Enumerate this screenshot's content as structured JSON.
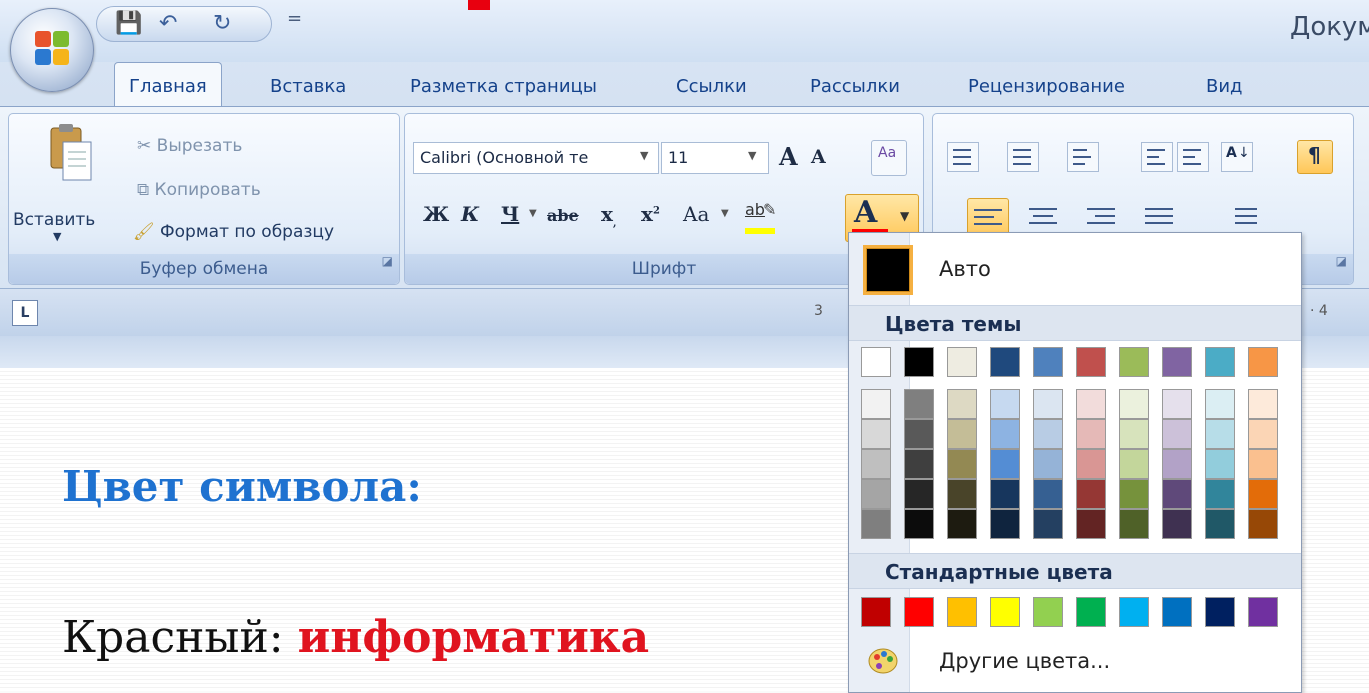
{
  "window": {
    "doc_title": "Докум"
  },
  "quick_access": {
    "icons": [
      "save-icon",
      "undo-icon",
      "redo-icon"
    ],
    "more": "="
  },
  "tabs": [
    "Главная",
    "Вставка",
    "Разметка страницы",
    "Ссылки",
    "Рассылки",
    "Рецензирование",
    "Вид"
  ],
  "clipboard": {
    "paste": "Вставить",
    "cut": "Вырезать",
    "copy": "Копировать",
    "format_painter": "Формат по образцу",
    "group_label": "Буфер обмена"
  },
  "font": {
    "font_name": "Calibri (Основной те",
    "font_size": "11",
    "grow": "A",
    "shrink": "A",
    "bold": "Ж",
    "italic": "К",
    "underline": "Ч",
    "strike": "abe",
    "subscript": "x",
    "superscript": "x",
    "change_case": "Aa",
    "highlight": "ab",
    "font_color": "A",
    "group_label": "Шрифт"
  },
  "paragraph": {
    "sort": "А",
    "show_marks": "¶"
  },
  "ruler": {
    "left_num": "3",
    "right_num": "· 4"
  },
  "font_color_menu": {
    "auto_label": "Авто",
    "theme_header": "Цвета темы",
    "theme_top_row": [
      "#ffffff",
      "#000000",
      "#eeece1",
      "#1f497d",
      "#4f81bd",
      "#c0504d",
      "#9bbb59",
      "#8064a2",
      "#4bacc6",
      "#f79646"
    ],
    "theme_shades": [
      [
        "#f2f2f2",
        "#7f7f7f",
        "#ddd9c3",
        "#c6d9f0",
        "#dbe5f1",
        "#f2dcdb",
        "#ebf1dd",
        "#e5e0ec",
        "#dbeef3",
        "#fdeada"
      ],
      [
        "#d8d8d8",
        "#595959",
        "#c4bd97",
        "#8db3e2",
        "#b8cce4",
        "#e5b9b7",
        "#d7e3bc",
        "#ccc1d9",
        "#b7dde8",
        "#fbd5b5"
      ],
      [
        "#bfbfbf",
        "#3f3f3f",
        "#938953",
        "#548dd4",
        "#95b3d7",
        "#d99694",
        "#c3d69b",
        "#b2a2c7",
        "#92cddc",
        "#fac08f"
      ],
      [
        "#a5a5a5",
        "#262626",
        "#494429",
        "#17365d",
        "#366092",
        "#953734",
        "#76923c",
        "#5f497a",
        "#31859b",
        "#e36c09"
      ],
      [
        "#7f7f7f",
        "#0c0c0c",
        "#1d1b10",
        "#0f243e",
        "#244061",
        "#632423",
        "#4f6128",
        "#3f3151",
        "#205867",
        "#974806"
      ]
    ],
    "standard_header": "Стандартные цвета",
    "standard_colors": [
      "#c00000",
      "#ff0000",
      "#ffc000",
      "#ffff00",
      "#92d050",
      "#00b050",
      "#00b0f0",
      "#0070c0",
      "#002060",
      "#7030a0"
    ],
    "more_colors": "Другие цвета..."
  },
  "slide": {
    "heading": "Цвет символа:",
    "example_prefix": "Красный: ",
    "example_word": "информатика"
  }
}
